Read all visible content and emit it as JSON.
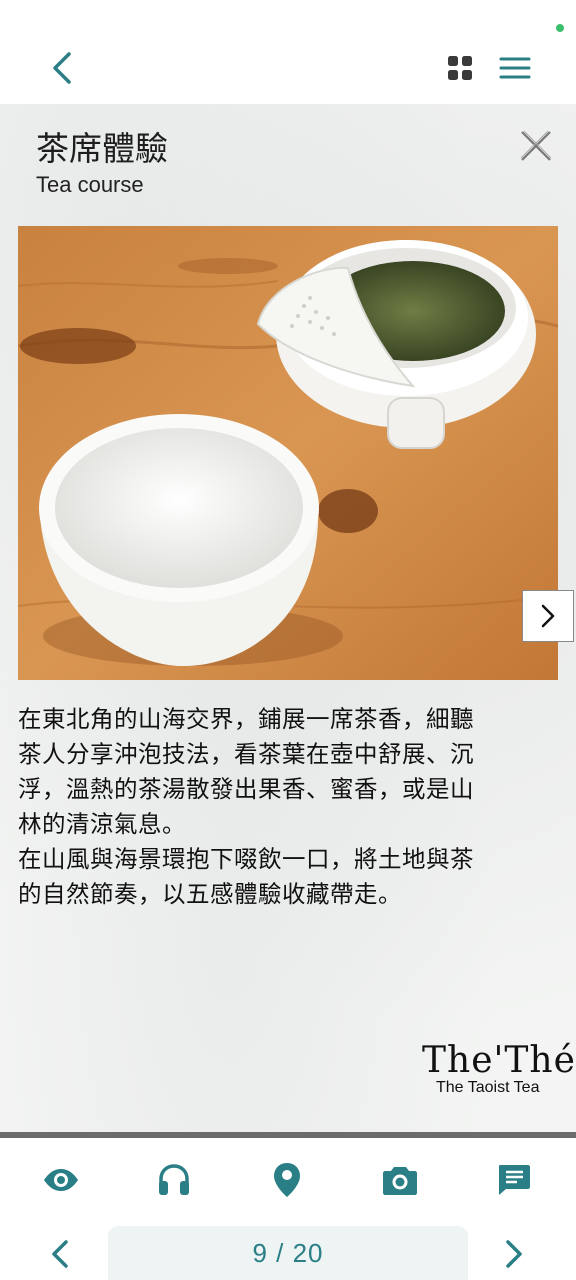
{
  "header": {
    "back_icon": "chevron-left-icon",
    "grid_icon": "grid-icon",
    "menu_icon": "hamburger-menu-icon",
    "accent_color": "#2a7f86"
  },
  "card": {
    "title": "茶席體驗",
    "subtitle": "Tea course",
    "close_icon": "close-icon",
    "photo_description_icon": "tea-set-photo",
    "next_icon": "chevron-right-icon",
    "body": "在東北角的山海交界，鋪展一席茶香，細聽\n茶人分享沖泡技法，看茶葉在壺中舒展、沉\n浮，溫熱的茶湯散發出果香、蜜香，或是山\n林的清涼氣息。\n在山風與海景環抱下啜飲一口，將土地與茶\n的自然節奏，以五感體驗收藏帶走。",
    "logo": {
      "main": "The'Thé",
      "sub": "The Taoist Tea"
    }
  },
  "toolbar": {
    "items": [
      {
        "icon": "eye-icon"
      },
      {
        "icon": "headphones-icon"
      },
      {
        "icon": "location-pin-icon"
      },
      {
        "icon": "camera-icon"
      },
      {
        "icon": "message-icon"
      }
    ]
  },
  "pager": {
    "current": 9,
    "total": 20,
    "label": "9 / 20"
  }
}
